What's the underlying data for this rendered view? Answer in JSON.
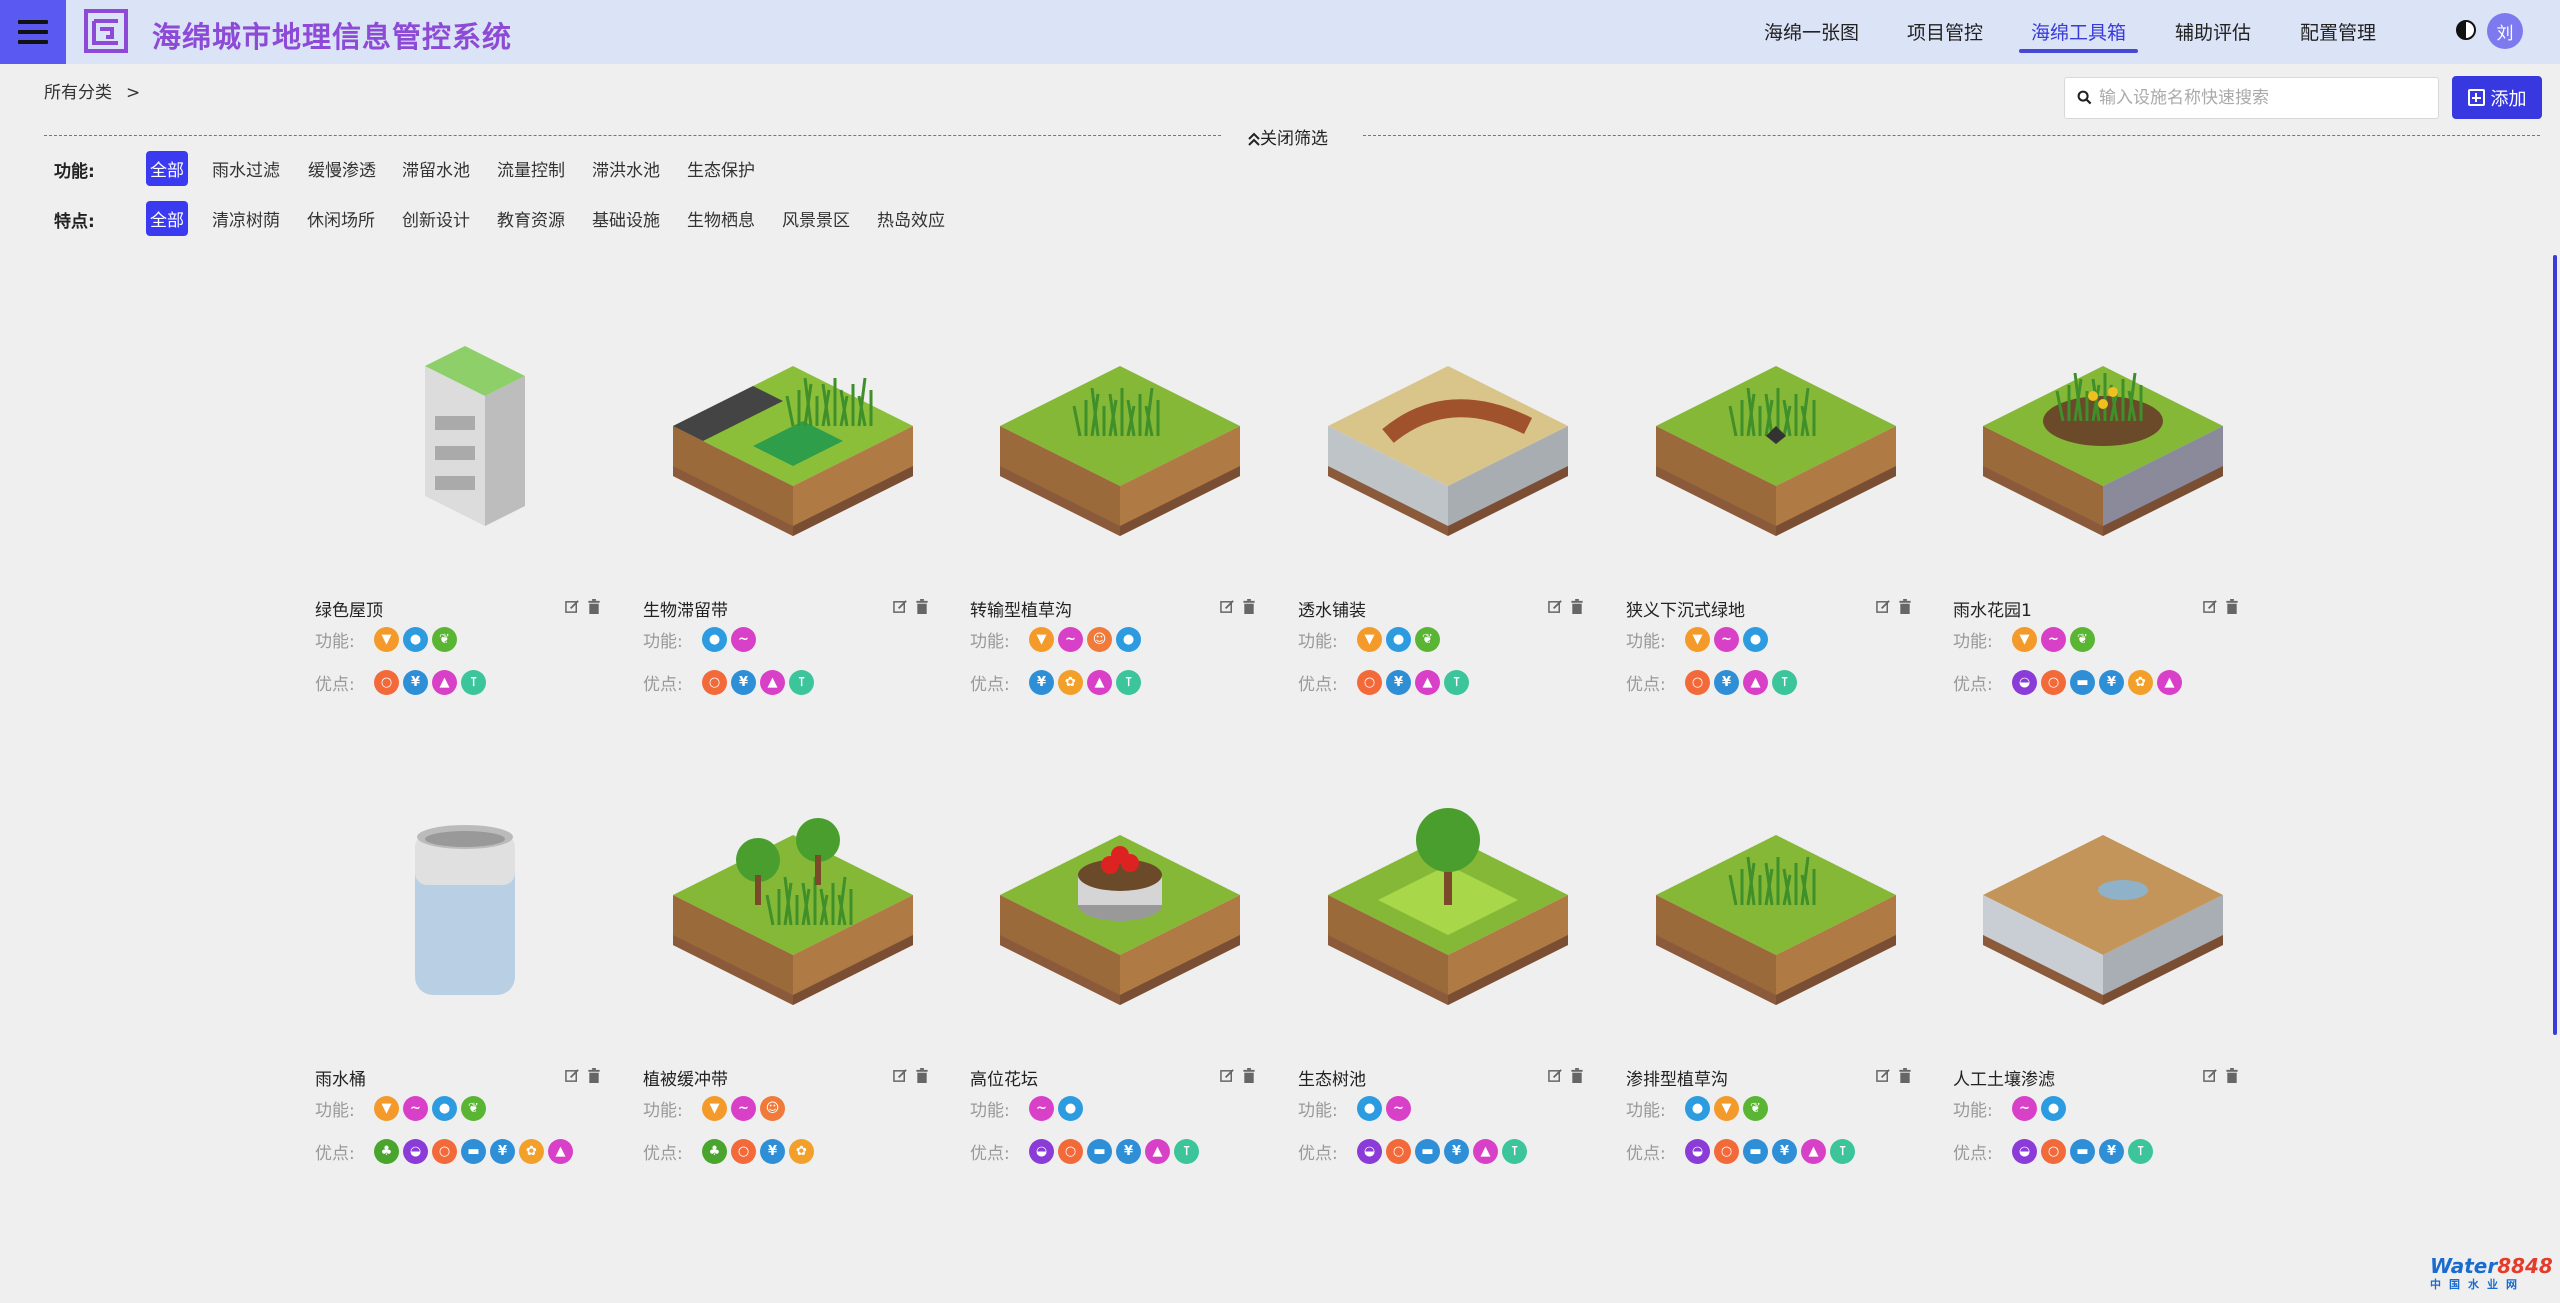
{
  "header": {
    "title": "海绵城市地理信息管控系统",
    "nav": [
      {
        "label": "海绵一张图"
      },
      {
        "label": "项目管控"
      },
      {
        "label": "海绵工具箱"
      },
      {
        "label": "辅助评估"
      },
      {
        "label": "配置管理"
      }
    ],
    "active_nav": "海绵工具箱",
    "avatar_text": "刘"
  },
  "breadcrumb": {
    "root": "所有分类",
    "sep": ">"
  },
  "search": {
    "placeholder": "输入设施名称快速搜索",
    "value": ""
  },
  "add_label": "添加",
  "close_filter_label": "关闭筛选",
  "filters": {
    "function": {
      "label": "功能:",
      "options": [
        "全部",
        "雨水过滤",
        "缓慢渗透",
        "滞留水池",
        "流量控制",
        "滞洪水池",
        "生态保护"
      ],
      "selected": "全部"
    },
    "feature": {
      "label": "特点:",
      "options": [
        "全部",
        "清凉树荫",
        "休闲场所",
        "创新设计",
        "教育资源",
        "基础设施",
        "生物栖息",
        "风景景区",
        "热岛效应"
      ],
      "selected": "全部"
    }
  },
  "card_labels": {
    "function": "功能:",
    "advantage": "优点:"
  },
  "icon_colors": {
    "filter": "#f39a2a",
    "drop": "#2d9be0",
    "leaf": "#5bb535",
    "bird": "#d940c8",
    "face": "#f07a3a",
    "yen": "#2f8fd6",
    "mountain": "#d940c8",
    "thermo": "#3cc59a",
    "bulb": "#f26a3a",
    "dish": "#8a3bd8",
    "grad": "#2f8fd6",
    "sun": "#f3a02a",
    "tree": "#4aa52e"
  },
  "cards": [
    {
      "name": "绿色屋顶",
      "image": "green-roof",
      "functions": [
        "filter",
        "drop",
        "leaf"
      ],
      "advantages": [
        "bulb",
        "yen",
        "mountain",
        "thermo"
      ]
    },
    {
      "name": "生物滞留带",
      "image": "bioretention",
      "functions": [
        "drop",
        "bird"
      ],
      "advantages": [
        "bulb",
        "yen",
        "mountain",
        "thermo"
      ]
    },
    {
      "name": "转输型植草沟",
      "image": "grass-swale",
      "functions": [
        "filter",
        "bird",
        "face",
        "drop"
      ],
      "advantages": [
        "yen",
        "sun",
        "mountain",
        "thermo"
      ]
    },
    {
      "name": "透水铺装",
      "image": "permeable-paving",
      "functions": [
        "filter",
        "drop",
        "leaf"
      ],
      "advantages": [
        "bulb",
        "yen",
        "mountain",
        "thermo"
      ]
    },
    {
      "name": "狭义下沉式绿地",
      "image": "sunken-greenland",
      "functions": [
        "filter",
        "bird",
        "drop"
      ],
      "advantages": [
        "bulb",
        "yen",
        "mountain",
        "thermo"
      ]
    },
    {
      "name": "雨水花园1",
      "image": "rain-garden",
      "functions": [
        "filter",
        "bird",
        "leaf"
      ],
      "advantages": [
        "dish",
        "bulb",
        "grad",
        "yen",
        "sun",
        "mountain"
      ]
    },
    {
      "name": "雨水桶",
      "image": "rain-barrel",
      "functions": [
        "filter",
        "bird",
        "drop",
        "leaf"
      ],
      "advantages": [
        "tree",
        "dish",
        "bulb",
        "grad",
        "yen",
        "sun",
        "mountain"
      ]
    },
    {
      "name": "植被缓冲带",
      "image": "vegetated-buffer",
      "functions": [
        "filter",
        "bird",
        "face"
      ],
      "advantages": [
        "tree",
        "bulb",
        "yen",
        "sun"
      ]
    },
    {
      "name": "高位花坛",
      "image": "raised-planter",
      "functions": [
        "bird",
        "drop"
      ],
      "advantages": [
        "dish",
        "bulb",
        "grad",
        "yen",
        "mountain",
        "thermo"
      ]
    },
    {
      "name": "生态树池",
      "image": "tree-pit",
      "functions": [
        "drop",
        "bird"
      ],
      "advantages": [
        "dish",
        "bulb",
        "grad",
        "yen",
        "mountain",
        "thermo"
      ]
    },
    {
      "name": "渗排型植草沟",
      "image": "infiltration-swale",
      "functions": [
        "drop",
        "filter",
        "leaf"
      ],
      "advantages": [
        "dish",
        "bulb",
        "grad",
        "yen",
        "mountain",
        "thermo"
      ]
    },
    {
      "name": "人工土壤渗滤",
      "image": "soil-infiltration",
      "functions": [
        "bird",
        "drop"
      ],
      "advantages": [
        "dish",
        "bulb",
        "grad",
        "yen",
        "thermo"
      ]
    }
  ],
  "watermark": {
    "brand_a": "Water",
    "brand_b": "8848",
    "sub": "中国水业网"
  }
}
